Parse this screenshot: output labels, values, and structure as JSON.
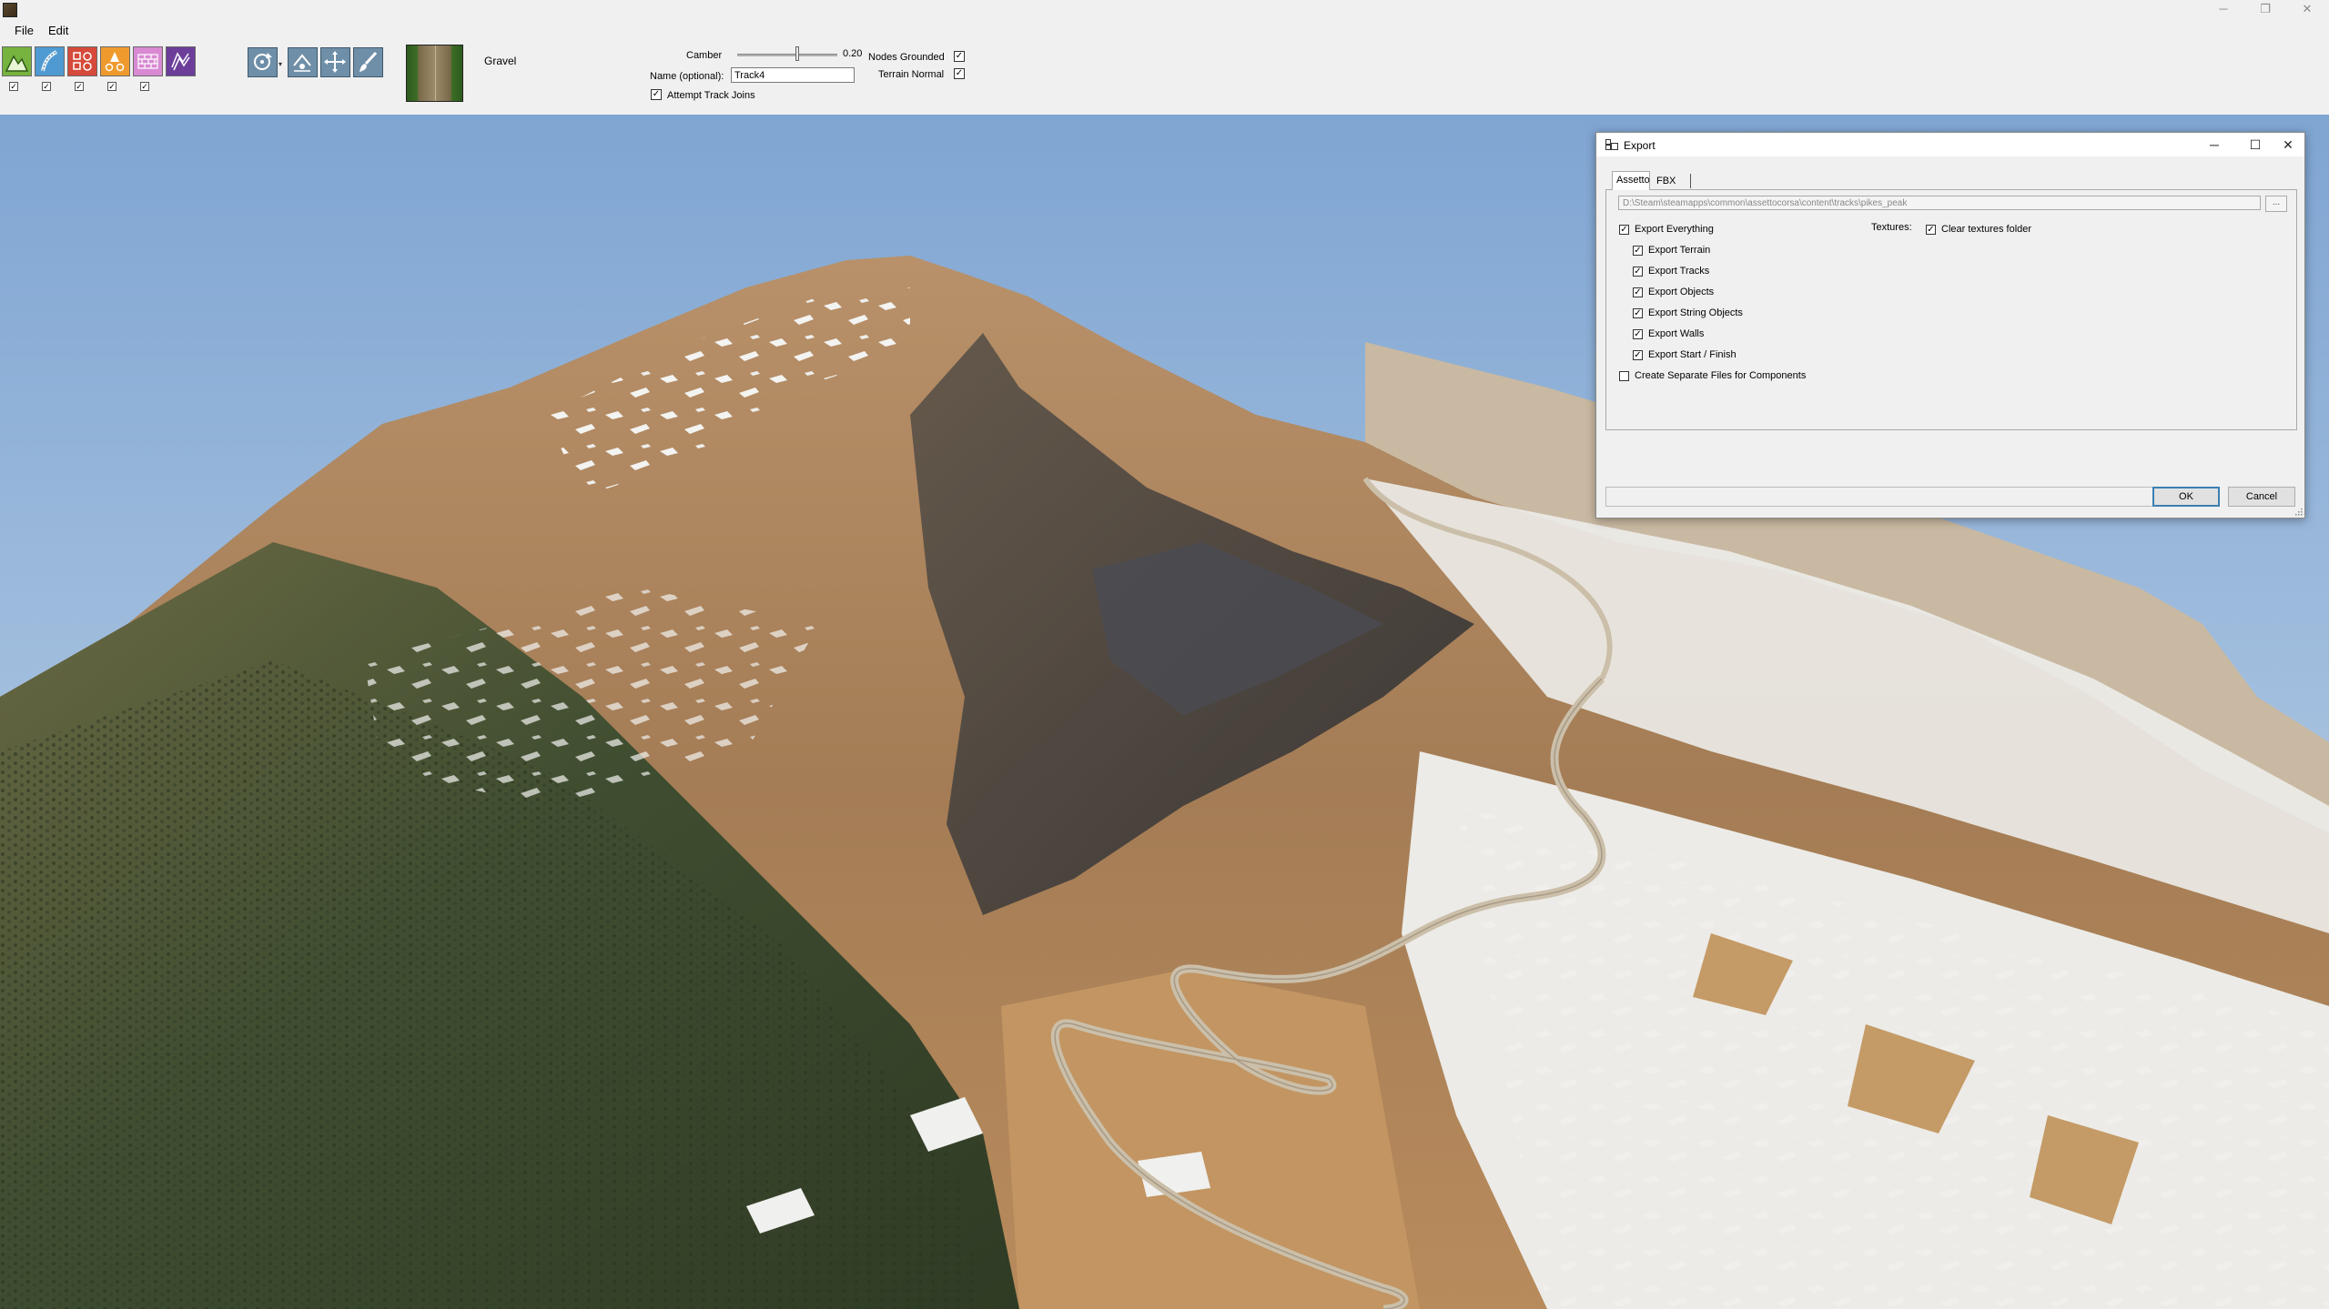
{
  "window": {
    "title": "",
    "controls": {
      "minimize": "─",
      "maximize": "❐",
      "close": "✕"
    }
  },
  "menu": {
    "items": [
      {
        "label": "File"
      },
      {
        "label": "Edit"
      }
    ]
  },
  "toolbar": {
    "tool_icons": [
      "terrain-icon",
      "road-brush-icon",
      "objects-icon",
      "cones-icon",
      "walls-icon",
      "start-finish-icon"
    ],
    "tool_checks": [
      true,
      true,
      true,
      true,
      true
    ],
    "camera_icons": [
      "orbit-camera-icon",
      "fly-camera-icon",
      "move-camera-icon",
      "paint-brush-icon"
    ],
    "texture_name": "Gravel",
    "camber_label": "Camber",
    "camber_value": "0.20",
    "name_label": "Name (optional):",
    "name_value": "Track4",
    "nodes_grounded_label": "Nodes Grounded",
    "nodes_grounded": true,
    "terrain_normal_label": "Terrain Normal",
    "terrain_normal": true,
    "attempt_joins_label": "Attempt Track Joins",
    "attempt_joins": true
  },
  "export_dialog": {
    "title": "Export",
    "controls": {
      "minimize": "─",
      "maximize": "☐",
      "close": "✕"
    },
    "tabs": [
      {
        "label": "Assetto",
        "active": true
      },
      {
        "label": "FBX",
        "active": false
      }
    ],
    "path": "D:\\Steam\\steamapps\\common\\assettocorsa\\content\\tracks\\pikes_peak",
    "browse_label": "...",
    "export_everything": {
      "label": "Export Everything",
      "checked": true
    },
    "options": [
      {
        "label": "Export Terrain",
        "checked": true
      },
      {
        "label": "Export Tracks",
        "checked": true
      },
      {
        "label": "Export Objects",
        "checked": true
      },
      {
        "label": "Export String Objects",
        "checked": true
      },
      {
        "label": "Export Walls",
        "checked": true
      },
      {
        "label": "Export Start / Finish",
        "checked": true
      }
    ],
    "separate_files": {
      "label": "Create Separate Files for Components",
      "checked": false
    },
    "textures_label": "Textures:",
    "clear_textures": {
      "label": "Clear textures folder",
      "checked": true
    },
    "ok_label": "OK",
    "cancel_label": "Cancel"
  },
  "colors": {
    "sky_top": "#7ea3cf",
    "sky_bottom": "#c3d6e8",
    "rock": "#a9825a",
    "snow": "#f2f2f0",
    "forest": "#3b4a2e",
    "road": "#c8bba5",
    "accent": "#3c7fb1"
  }
}
